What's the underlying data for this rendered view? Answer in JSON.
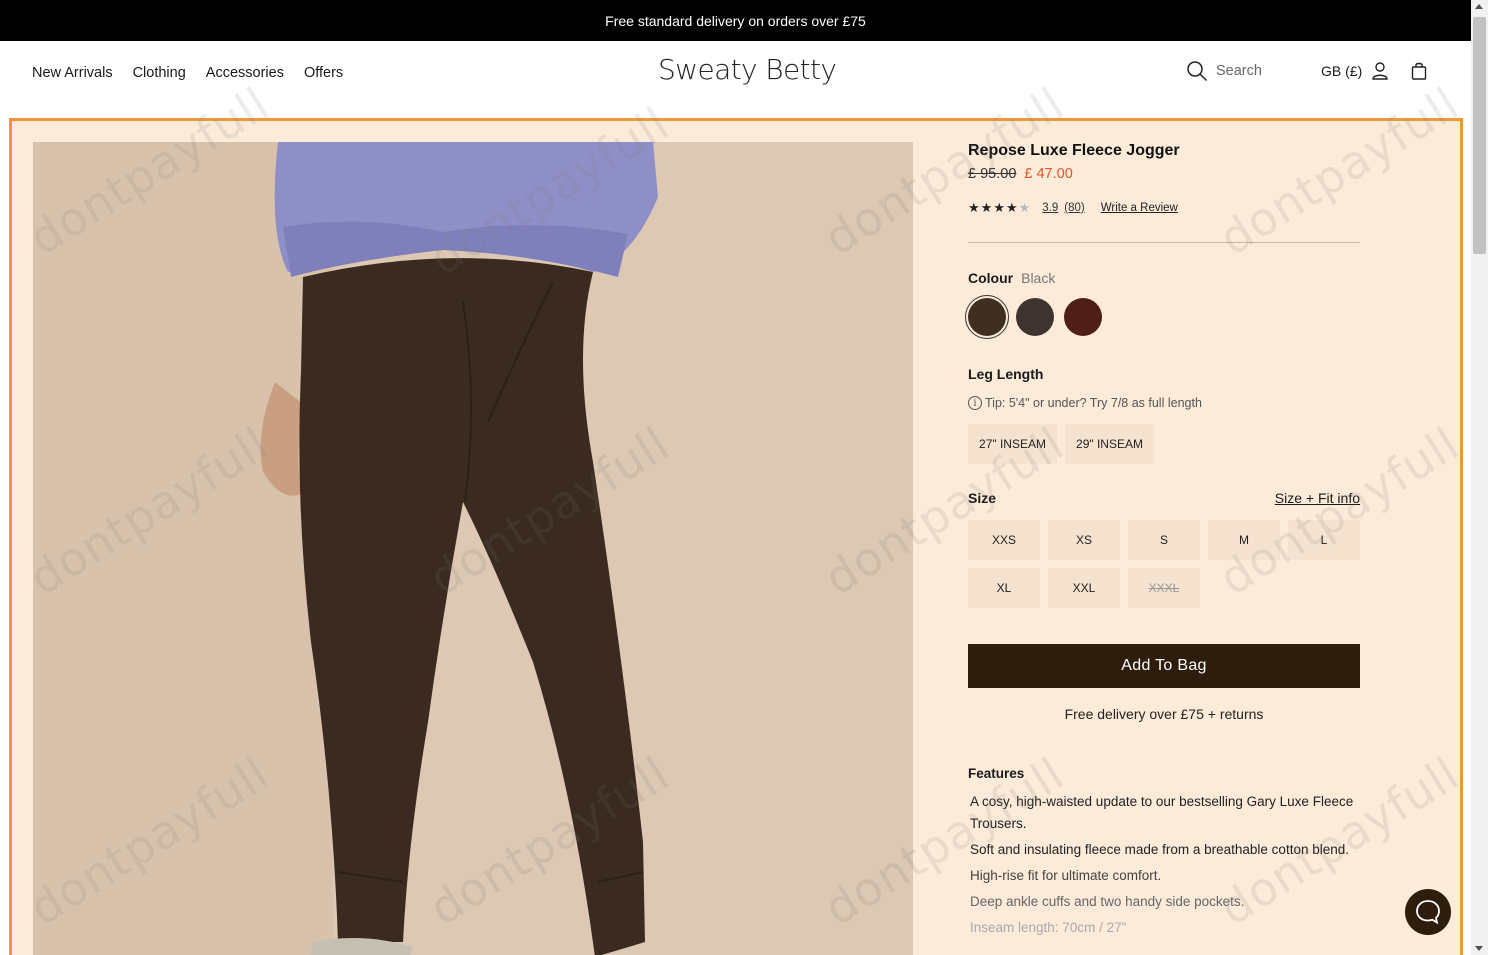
{
  "promo": {
    "text": "Free standard delivery on orders over £75"
  },
  "header": {
    "nav": [
      "New Arrivals",
      "Clothing",
      "Accessories",
      "Offers"
    ],
    "logo": "Sweaty Betty",
    "search_placeholder": "Search",
    "region": "GB (£)"
  },
  "product": {
    "title": "Repose Luxe Fleece Jogger",
    "old_price": "£ 95.00",
    "new_price": "£ 47.00",
    "rating": {
      "stars": 3.9,
      "value": "3.9",
      "count": "(80)",
      "write_review": "Write a Review"
    },
    "colour": {
      "label": "Colour",
      "value": "Black",
      "swatches": [
        "#3f2f22",
        "#3d3430",
        "#4f1f17"
      ]
    },
    "leg_length": {
      "label": "Leg Length",
      "tip": "Tip: 5'4\" or under? Try 7/8 as full length",
      "options": [
        "27\" INSEAM",
        "29\" INSEAM"
      ]
    },
    "size": {
      "label": "Size",
      "fit_link": "Size + Fit info",
      "options": [
        "XXS",
        "XS",
        "S",
        "M",
        "L",
        "XL",
        "XXL",
        "XXXL"
      ],
      "out_of_stock": [
        "XXXL"
      ]
    },
    "add_to_bag": "Add To Bag",
    "delivery_note": "Free delivery over £75 + returns",
    "features_title": "Features",
    "features": [
      "A cosy, high-waisted update to our bestselling Gary Luxe Fleece Trousers.",
      "Soft and insulating fleece made from a breathable cotton blend.",
      "High-rise fit for ultimate comfort.",
      "Deep ankle cuffs and two handy side pockets.",
      "Inseam length: 70cm / 27\""
    ]
  },
  "watermark": "dontpayfull",
  "colors": {
    "accent": "#f0973c",
    "panel": "#fdebd9",
    "sale": "#e0542b",
    "button": "#2e1c0c"
  }
}
